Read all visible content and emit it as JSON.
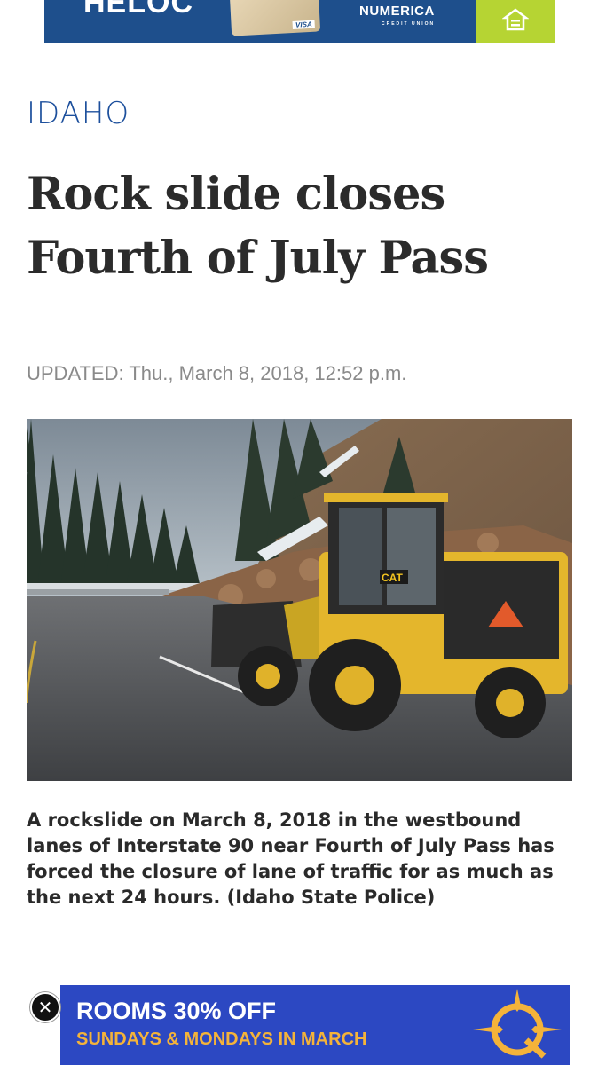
{
  "top_ad": {
    "headline": "HELOC",
    "card_brand": "VISA",
    "advertiser": "NUMERICA",
    "advertiser_sub": "CREDIT UNION",
    "lender_icon": "equal-housing-lender-icon",
    "colors": {
      "background": "#1e4f8c",
      "accent": "#b6d433"
    }
  },
  "article": {
    "section": "IDAHO",
    "headline": "Rock slide closes Fourth of July Pass",
    "updated": "UPDATED: Thu., March 8, 2018, 12:52 p.m.",
    "photo_caption": "A rockslide on March 8, 2018 in the westbound lanes of Interstate 90 near Fourth of July Pass has forced the closure of lane of traffic for as much as the next 24 hours. (Idaho State Police)",
    "loader_badge": "CAT"
  },
  "bottom_ad": {
    "headline": "ROOMS 30% OFF",
    "subline": "SUNDAYS & MONDAYS IN MARCH",
    "logo_letter": "Q",
    "close_label": "✕",
    "colors": {
      "background": "#2c48c2",
      "subline": "#f4b33a"
    }
  },
  "colors": {
    "section_label": "#1c4f9c",
    "headline": "#2b2b2b",
    "meta": "#8a8a8a"
  }
}
